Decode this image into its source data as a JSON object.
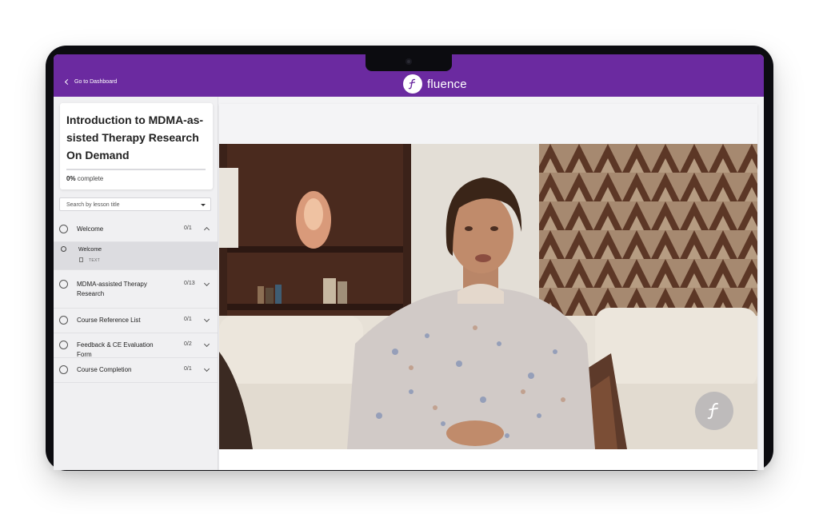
{
  "topbar": {
    "back_label": "Go to Dashboard",
    "brand_name": "fluence",
    "color": "#6b2aa0"
  },
  "course": {
    "title": "Introduction to MDMA-as-sisted Therapy Research On Demand",
    "progress_value": "0%",
    "progress_suffix": "complete",
    "progress_fraction": 0
  },
  "search": {
    "placeholder": "Search by lesson title"
  },
  "sections": [
    {
      "label": "Welcome",
      "count": "0/1",
      "expanded": true
    },
    {
      "label": "MDMA-assisted Therapy Research",
      "count": "0/13",
      "expanded": false
    },
    {
      "label": "Course Reference List",
      "count": "0/1",
      "expanded": false
    },
    {
      "label": "Feedback & CE Evaluation Form",
      "count": "0/2",
      "expanded": false
    },
    {
      "label": "Course Completion",
      "count": "0/1",
      "expanded": false
    }
  ],
  "lesson": {
    "title": "Welcome",
    "type": "TEXT"
  },
  "icons": {
    "back": "chevron-left-icon",
    "logo": "fluence-logo-icon",
    "dropdown": "caret-down-icon",
    "expand": "chevron-down-icon",
    "collapse": "chevron-up-icon",
    "lesson_type": "document-icon",
    "watermark": "fluence-watermark-icon"
  }
}
